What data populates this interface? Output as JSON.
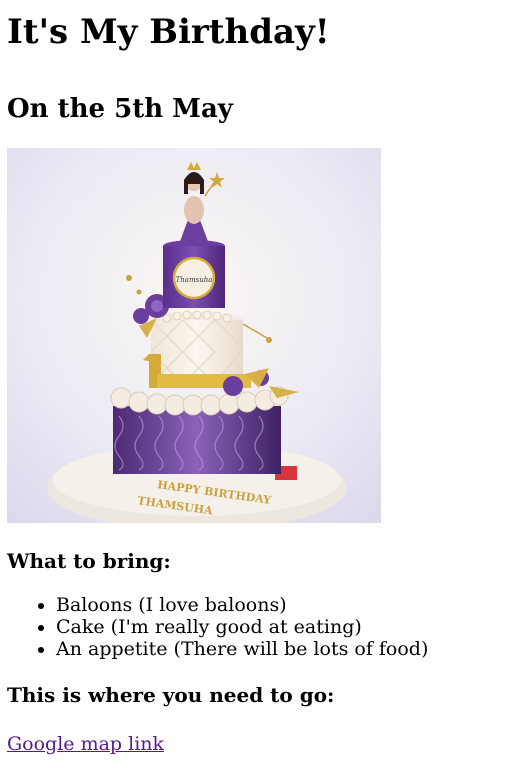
{
  "page": {
    "title": "It's My Birthday!",
    "date_heading": "On the 5th May"
  },
  "image": {
    "alt": "Purple and gold three tier birthday cake",
    "cake_text": "HAPPY BIRTHDAY THAMSUHA",
    "number_shown": "1"
  },
  "bring": {
    "heading": "What to bring:",
    "items": [
      "Baloons (I love baloons)",
      "Cake (I'm really good at eating)",
      "An appetite (There will be lots of food)"
    ]
  },
  "directions": {
    "heading": "This is where you need to go:",
    "link_label": "Google map link"
  },
  "colors": {
    "link": "#551a8b",
    "cake_purple": "#6b3fa0",
    "gold": "#d8b04a"
  }
}
